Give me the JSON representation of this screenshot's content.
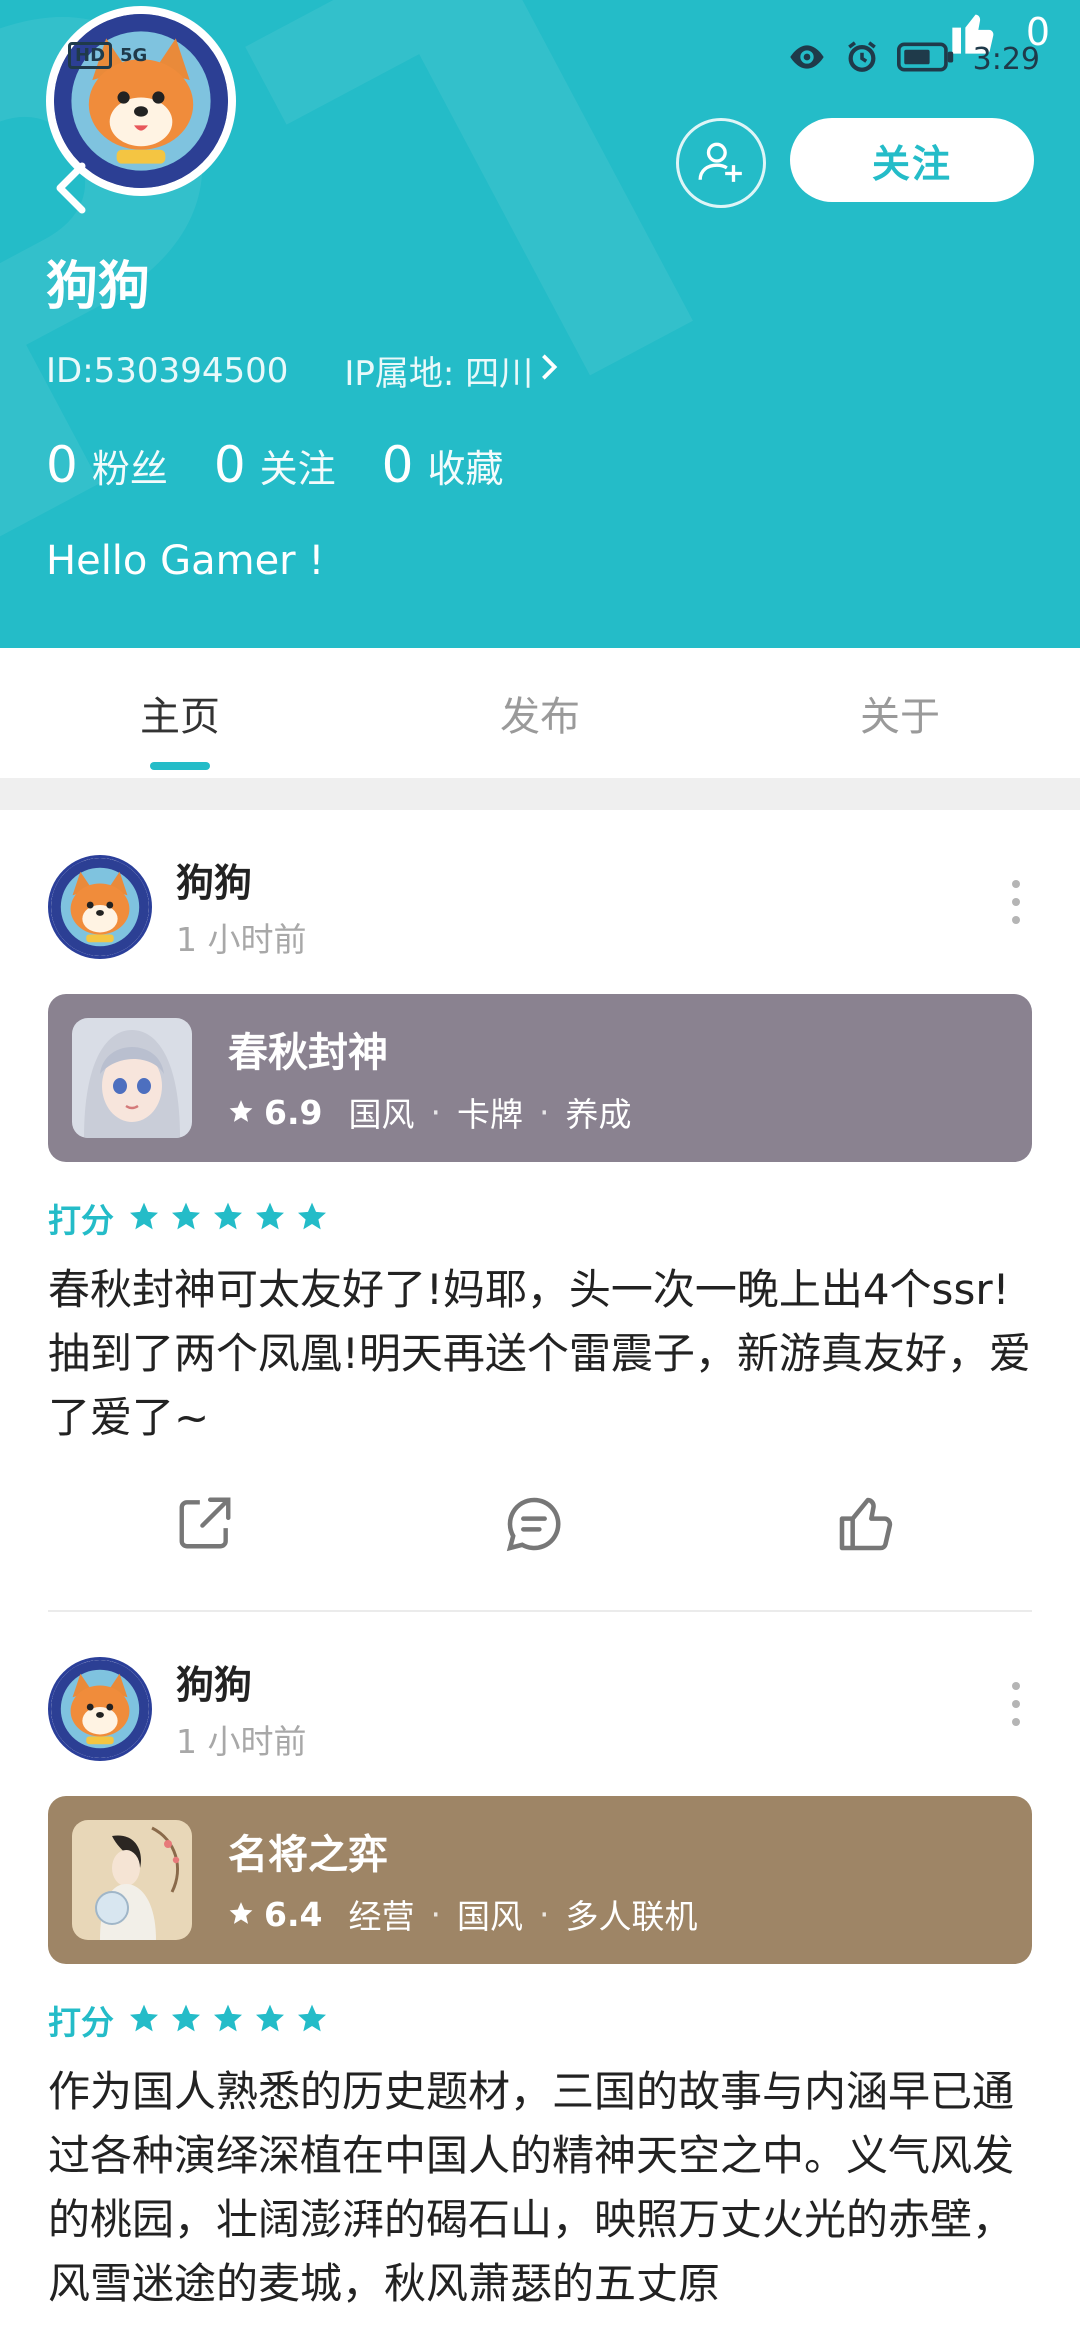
{
  "status_bar": {
    "left_tags": [
      "HD",
      "5G"
    ],
    "time": "3:29",
    "like_count": "0"
  },
  "profile": {
    "nickname": "狗狗",
    "id_text": "ID:530394500",
    "ip_text": "IP属地: 四川",
    "follow_label": "关注",
    "stats": [
      {
        "num": "0",
        "label": "粉丝"
      },
      {
        "num": "0",
        "label": "关注"
      },
      {
        "num": "0",
        "label": "收藏"
      }
    ],
    "bio": "Hello Gamer !"
  },
  "tabs": [
    {
      "label": "主页",
      "active": true
    },
    {
      "label": "发布",
      "active": false
    },
    {
      "label": "关于",
      "active": false
    }
  ],
  "posts": [
    {
      "author": "狗狗",
      "time": "1 小时前",
      "game": {
        "name": "春秋封神",
        "score": "6.9",
        "tags": [
          "国风",
          "卡牌",
          "养成"
        ],
        "card_color": "#8A8290"
      },
      "rating_label": "打分",
      "rating_stars": 5,
      "text": "春秋封神可太友好了!妈耶，头一次一晚上出4个ssr!抽到了两个凤凰!明天再送个雷震子，新游真友好，爱了爱了~"
    },
    {
      "author": "狗狗",
      "time": "1 小时前",
      "game": {
        "name": "名将之弈",
        "score": "6.4",
        "tags": [
          "经营",
          "国风",
          "多人联机"
        ],
        "card_color": "#9E8566"
      },
      "rating_label": "打分",
      "rating_stars": 5,
      "text": "作为国人熟悉的历史题材，三国的故事与内涵早已通过各种演绎深植在中国人的精神天空之中。义气风发的桃园，壮阔澎湃的碣石山，映照万丈火光的赤壁，风雪迷途的麦城，秋风萧瑟的五丈原"
    }
  ],
  "colors": {
    "accent": "#24BCC8",
    "header_bg": "#24BCC8"
  }
}
